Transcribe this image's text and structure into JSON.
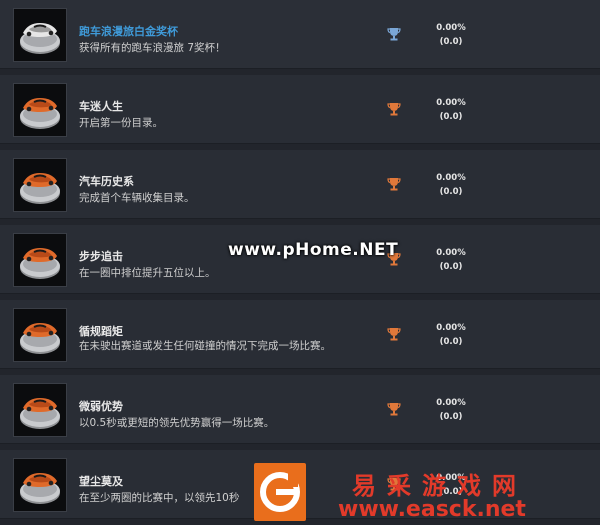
{
  "achievements": [
    {
      "title": "跑车浪漫旅白金奖杯",
      "desc": "获得所有的跑车浪漫旅 7奖杯！",
      "trophy": "platinum",
      "percent": "0.00%",
      "count": "(0.0)"
    },
    {
      "title": "车迷人生",
      "desc": "开启第一份目录。",
      "trophy": "bronze",
      "percent": "0.00%",
      "count": "(0.0)"
    },
    {
      "title": "汽车历史系",
      "desc": "完成首个车辆收集目录。",
      "trophy": "bronze",
      "percent": "0.00%",
      "count": "(0.0)"
    },
    {
      "title": "步步追击",
      "desc": "在一圈中排位提升五位以上。",
      "trophy": "bronze",
      "percent": "0.00%",
      "count": "(0.0)"
    },
    {
      "title": "循规蹈矩",
      "desc": "在未驶出赛道或发生任何碰撞的情况下完成一场比赛。",
      "trophy": "bronze",
      "percent": "0.00%",
      "count": "(0.0)"
    },
    {
      "title": "微弱优势",
      "desc": "以0.5秒或更短的领先优势赢得一场比赛。",
      "trophy": "bronze",
      "percent": "0.00%",
      "count": "(0.0)"
    },
    {
      "title": "望尘莫及",
      "desc": "在至少两圈的比赛中，以领先10秒",
      "trophy": "bronze",
      "percent": "0.00%",
      "count": "(0.0)"
    }
  ],
  "watermark_mid": "www.pHome.NET",
  "watermark_cn": "易采游戏网",
  "watermark_url": "www.easck.net",
  "colors": {
    "platinum_trophy": "#7aa6d6",
    "bronze_trophy": "#e0783a",
    "title_highlight": "#3f9ad8",
    "watermark": "#e23a2a"
  }
}
